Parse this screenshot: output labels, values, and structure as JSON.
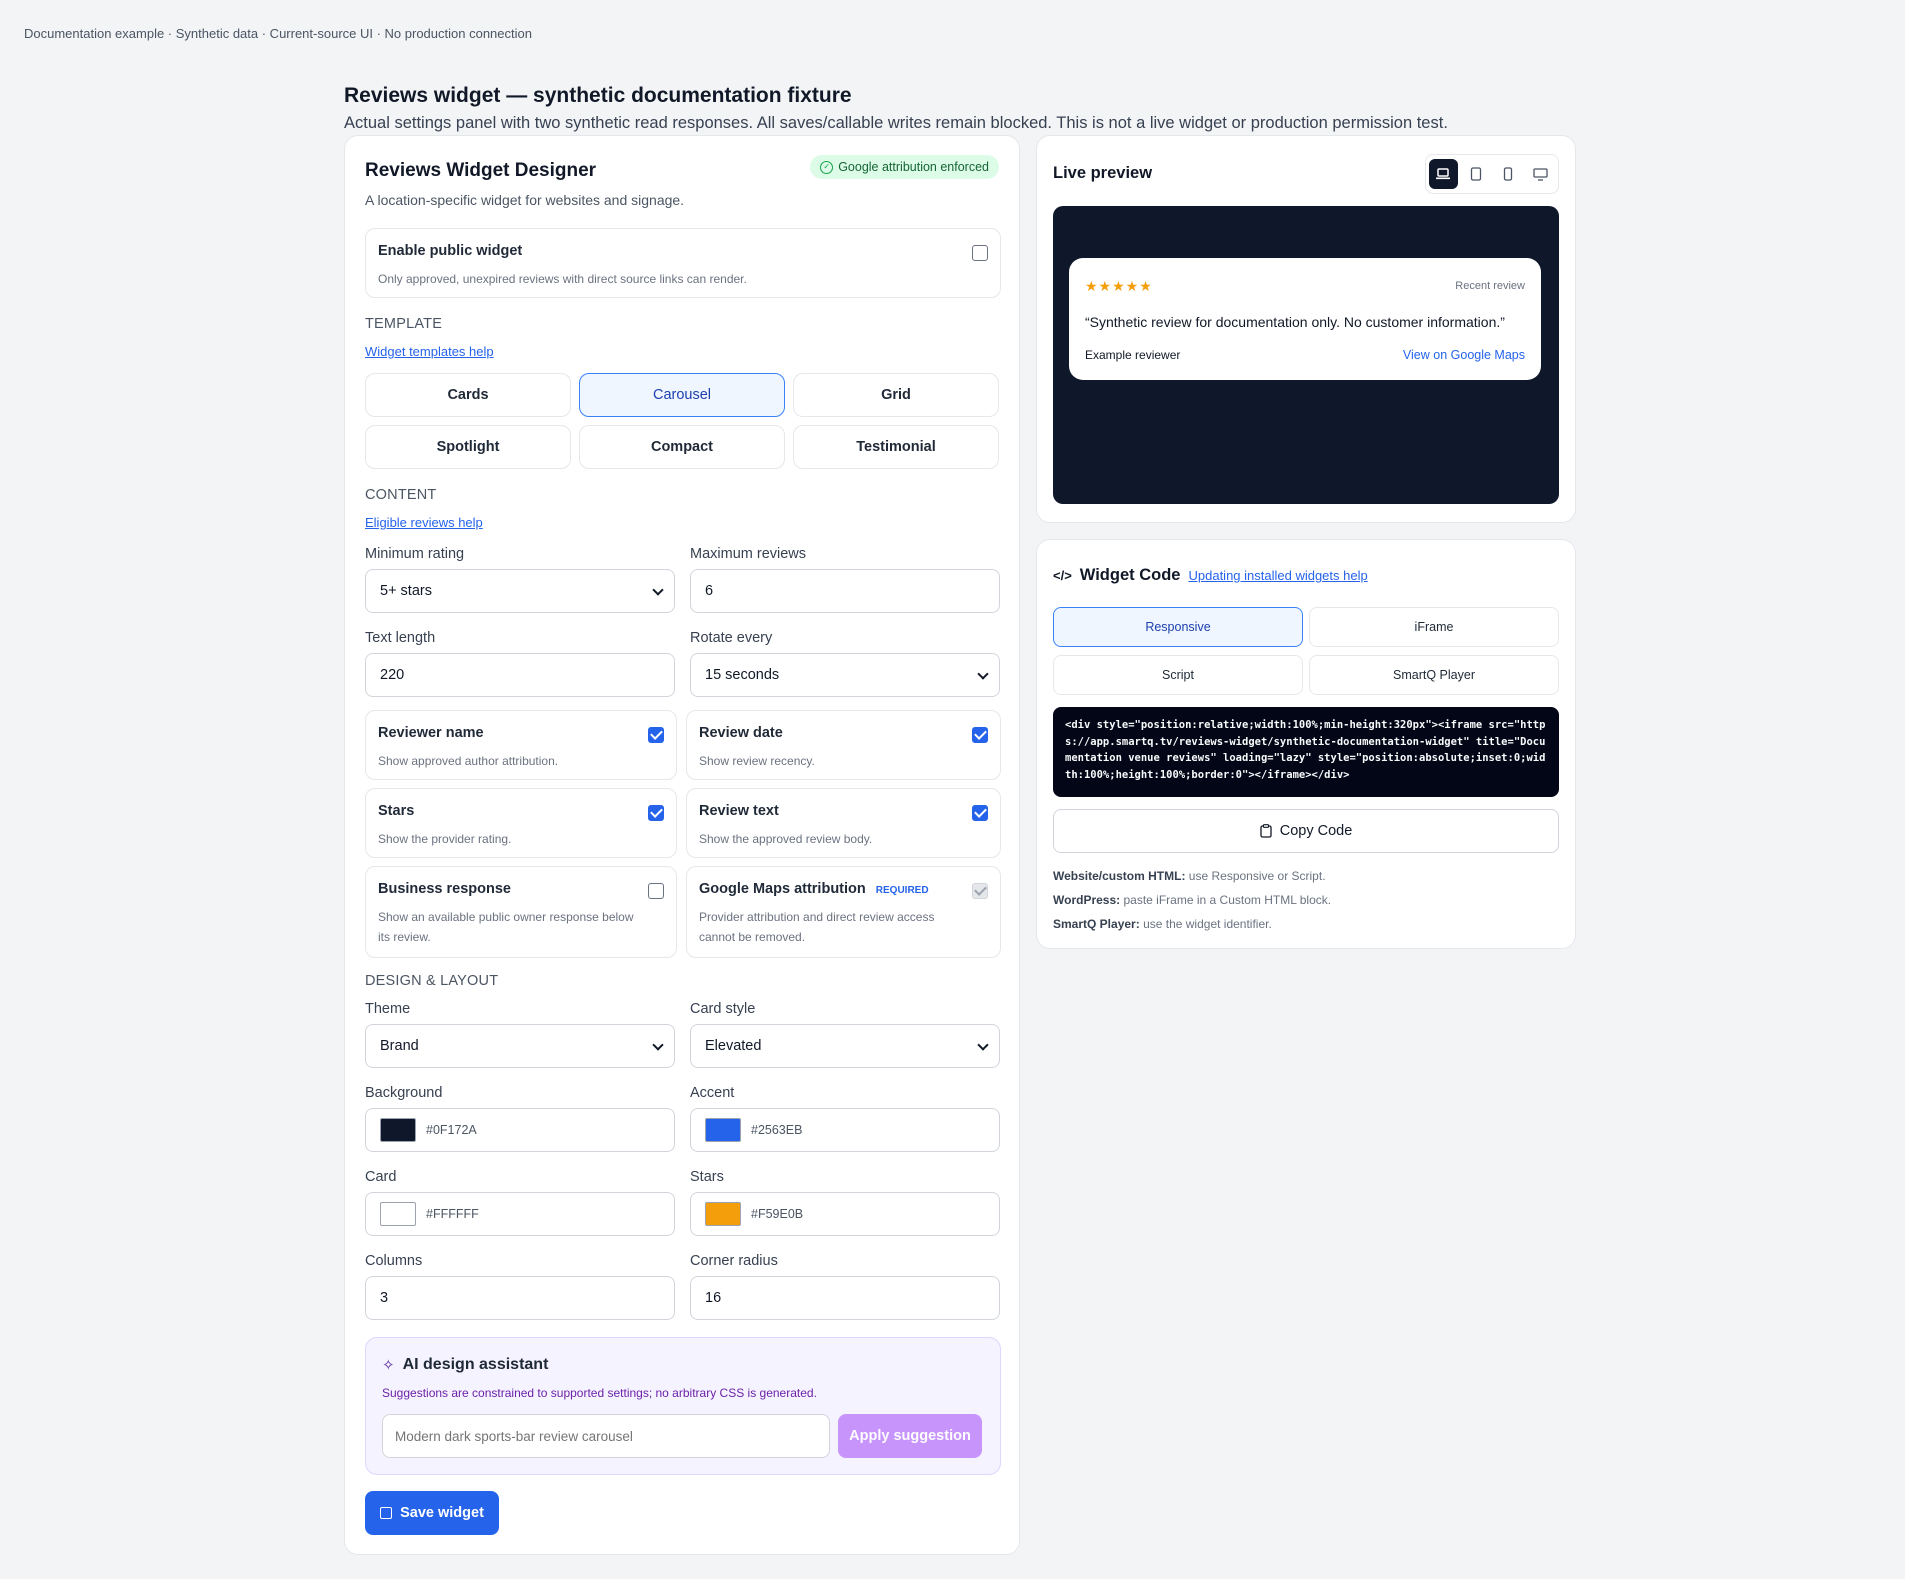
{
  "topnote": "Documentation example · Synthetic data · Current-source UI · No production connection",
  "header": {
    "title": "Reviews widget — synthetic documentation fixture",
    "subtitle": "Actual settings panel with two synthetic read responses. All saves/callable writes remain blocked. This is not a live widget or production permission test."
  },
  "designer": {
    "title": "Reviews Widget Designer",
    "badge": "Google attribution enforced",
    "description": "A location-specific widget for websites and signage.",
    "enable": {
      "label": "Enable public widget",
      "desc": "Only approved, unexpired reviews with direct source links can render.",
      "checked": false
    },
    "template_heading": "TEMPLATE",
    "template_help": "Widget templates help",
    "templates": [
      "Cards",
      "Carousel",
      "Grid",
      "Spotlight",
      "Compact",
      "Testimonial"
    ],
    "selected_template": "Carousel",
    "content_heading": "CONTENT",
    "content_help": "Eligible reviews help",
    "min_rating": {
      "label": "Minimum rating",
      "value": "5+ stars"
    },
    "max_reviews": {
      "label": "Maximum reviews",
      "value": "6"
    },
    "text_length": {
      "label": "Text length",
      "value": "220"
    },
    "rotate_every": {
      "label": "Rotate every",
      "value": "15 seconds"
    },
    "options": [
      {
        "label": "Reviewer name",
        "desc": "Show approved author attribution.",
        "state": "on"
      },
      {
        "label": "Review date",
        "desc": "Show review recency.",
        "state": "on"
      },
      {
        "label": "Stars",
        "desc": "Show the provider rating.",
        "state": "on"
      },
      {
        "label": "Review text",
        "desc": "Show the approved review body.",
        "state": "on"
      },
      {
        "label": "Business response",
        "desc": "Show an available public owner response below its review.",
        "state": "off"
      },
      {
        "label": "Google Maps attribution",
        "tag": "REQUIRED",
        "desc": "Provider attribution and direct review access cannot be removed.",
        "state": "disabled"
      }
    ],
    "design_heading": "DESIGN & LAYOUT",
    "theme": {
      "label": "Theme",
      "value": "Brand"
    },
    "card_style": {
      "label": "Card style",
      "value": "Elevated"
    },
    "background": {
      "label": "Background",
      "value": "#0F172A",
      "color": "#0F172A"
    },
    "accent": {
      "label": "Accent",
      "value": "#2563EB",
      "color": "#2563EB"
    },
    "card": {
      "label": "Card",
      "value": "#FFFFFF",
      "color": "#FFFFFF"
    },
    "stars": {
      "label": "Stars",
      "value": "#F59E0B",
      "color": "#F59E0B"
    },
    "columns": {
      "label": "Columns",
      "value": "3"
    },
    "corner_radius": {
      "label": "Corner radius",
      "value": "16"
    },
    "ai": {
      "title": "AI design assistant",
      "desc": "Suggestions are constrained to supported settings; no arbitrary CSS is generated.",
      "placeholder": "Modern dark sports-bar review carousel",
      "button": "Apply suggestion"
    },
    "save_label": "Save widget"
  },
  "preview": {
    "title": "Live preview",
    "devices": [
      "laptop-icon",
      "tablet-icon",
      "phone-icon",
      "monitor-icon"
    ],
    "active_device": "laptop-icon",
    "stars": "★★★★★",
    "tag": "Recent review",
    "quote": "“Synthetic review for documentation only. No customer information.”",
    "reviewer": "Example reviewer",
    "link": "View on Google Maps"
  },
  "code": {
    "title": "Widget Code",
    "help": "Updating installed widgets help",
    "tabs": [
      "Responsive",
      "iFrame",
      "Script",
      "SmartQ Player"
    ],
    "selected_tab": "Responsive",
    "snippet": "<div style=\"position:relative;width:100%;min-height:320px\"><iframe src=\"https://app.smartq.tv/reviews-widget/synthetic-documentation-widget\" title=\"Documentation venue reviews\" loading=\"lazy\" style=\"position:absolute;inset:0;width:100%;height:100%;border:0\"></iframe></div>",
    "copy_label": "Copy Code",
    "notes": [
      {
        "label": "Website/custom HTML:",
        "text": "use Responsive or Script."
      },
      {
        "label": "WordPress:",
        "text": "paste iFrame in a Custom HTML block."
      },
      {
        "label": "SmartQ Player:",
        "text": "use the widget identifier."
      }
    ]
  }
}
